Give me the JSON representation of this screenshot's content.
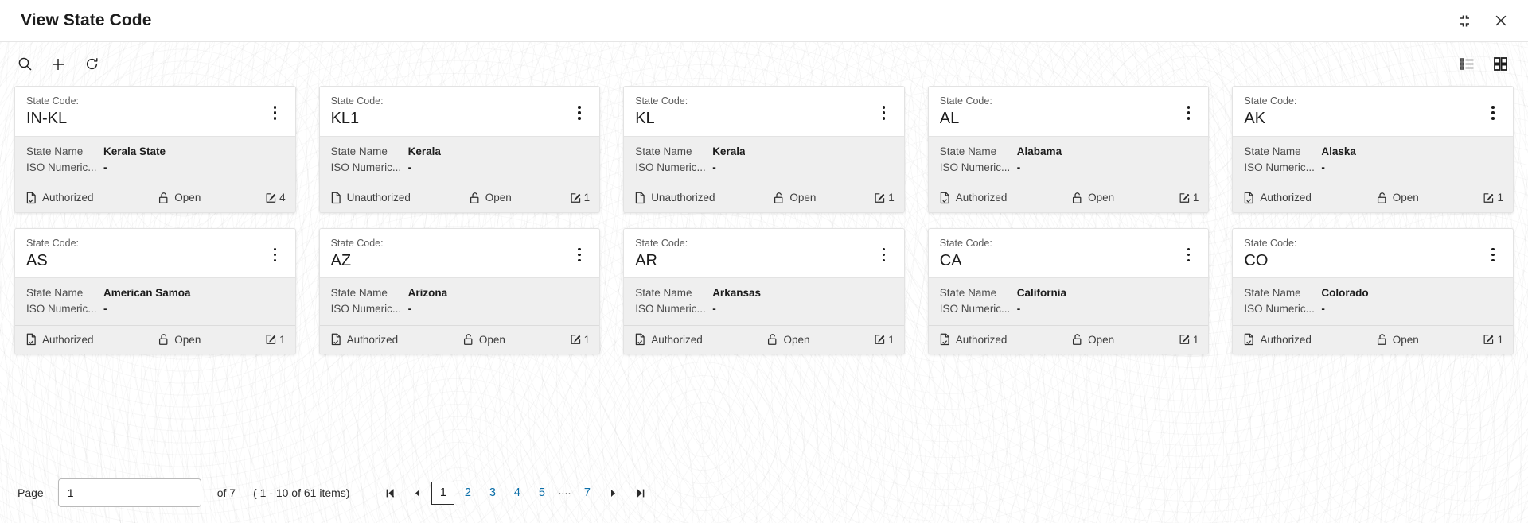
{
  "window": {
    "title": "View State Code",
    "collapse_icon": "collapse-icon",
    "close_icon": "close-icon"
  },
  "toolbar": {
    "search_icon": "search-icon",
    "add_icon": "plus-icon",
    "refresh_icon": "refresh-icon",
    "list_view_icon": "list-view-icon",
    "grid_view_icon": "grid-view-icon"
  },
  "card_fields": {
    "code_label": "State Code:",
    "name_key": "State Name",
    "iso_key": "ISO Numeric...",
    "auth_icon_authorized": "document-check-icon",
    "auth_icon_unauthorized": "document-icon",
    "lock_icon": "unlock-icon",
    "edit_icon": "edit-square-icon",
    "kebab_icon": "more-vertical-icon"
  },
  "cards": [
    {
      "code": "IN-KL",
      "state_name": "Kerala State",
      "iso_numeric": "-",
      "auth_status": "Authorized",
      "authorized": true,
      "lock_status": "Open",
      "edit_count": "4"
    },
    {
      "code": "KL1",
      "state_name": "Kerala",
      "iso_numeric": "-",
      "auth_status": "Unauthorized",
      "authorized": false,
      "lock_status": "Open",
      "edit_count": "1"
    },
    {
      "code": "KL",
      "state_name": "Kerala",
      "iso_numeric": "-",
      "auth_status": "Unauthorized",
      "authorized": false,
      "lock_status": "Open",
      "edit_count": "1"
    },
    {
      "code": "AL",
      "state_name": "Alabama",
      "iso_numeric": "-",
      "auth_status": "Authorized",
      "authorized": true,
      "lock_status": "Open",
      "edit_count": "1"
    },
    {
      "code": "AK",
      "state_name": "Alaska",
      "iso_numeric": "-",
      "auth_status": "Authorized",
      "authorized": true,
      "lock_status": "Open",
      "edit_count": "1"
    },
    {
      "code": "AS",
      "state_name": "American Samoa",
      "iso_numeric": "-",
      "auth_status": "Authorized",
      "authorized": true,
      "lock_status": "Open",
      "edit_count": "1"
    },
    {
      "code": "AZ",
      "state_name": "Arizona",
      "iso_numeric": "-",
      "auth_status": "Authorized",
      "authorized": true,
      "lock_status": "Open",
      "edit_count": "1"
    },
    {
      "code": "AR",
      "state_name": "Arkansas",
      "iso_numeric": "-",
      "auth_status": "Authorized",
      "authorized": true,
      "lock_status": "Open",
      "edit_count": "1"
    },
    {
      "code": "CA",
      "state_name": "California",
      "iso_numeric": "-",
      "auth_status": "Authorized",
      "authorized": true,
      "lock_status": "Open",
      "edit_count": "1"
    },
    {
      "code": "CO",
      "state_name": "Colorado",
      "iso_numeric": "-",
      "auth_status": "Authorized",
      "authorized": true,
      "lock_status": "Open",
      "edit_count": "1"
    }
  ],
  "pagination": {
    "page_label": "Page",
    "page_value": "1",
    "of_text": "of 7",
    "range_text": "( 1 - 10 of 61 items)",
    "first_icon": "first-page-icon",
    "prev_icon": "prev-page-icon",
    "next_icon": "next-page-icon",
    "last_icon": "last-page-icon",
    "pages": [
      "1",
      "2",
      "3",
      "4",
      "5"
    ],
    "ellipsis": "....",
    "last_page": "7",
    "active_page": "1"
  },
  "colors": {
    "link_blue": "#0a6ea8",
    "card_body_gray": "#efefef",
    "text_dark": "#1c1c1c"
  }
}
